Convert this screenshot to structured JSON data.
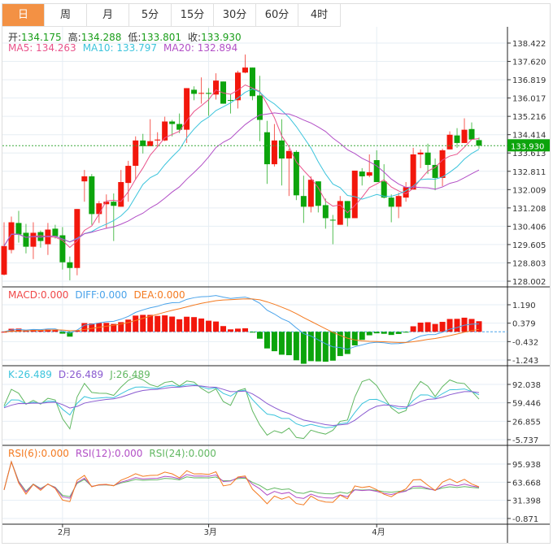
{
  "tabs": [
    "日",
    "周",
    "月",
    "5分",
    "15分",
    "30分",
    "60分",
    "4时"
  ],
  "active_tab": 0,
  "ohlc_legend": {
    "open_label": "开:",
    "open": "134.175",
    "high_label": "高:",
    "high": "134.288",
    "low_label": "低:",
    "low": "133.801",
    "close_label": "收:",
    "close": "133.930"
  },
  "ma_legend": {
    "ma5": "MA5: 134.263",
    "ma10": "MA10: 133.797",
    "ma20": "MA20: 132.894"
  },
  "macd_legend": {
    "macd": "MACD:0.000",
    "diff": "DIFF:0.000",
    "dea": "DEA:0.000"
  },
  "kdj_legend": {
    "k": "K:26.489",
    "d": "D:26.489",
    "j": "J:26.489"
  },
  "rsi_legend": {
    "rsi6": "RSI(6):0.000",
    "rsi12": "RSI(12):0.000",
    "rsi24": "RSI(24):0.000"
  },
  "colors": {
    "up": "#f2170c",
    "down": "#0ca40c",
    "ma5": "#e9528a",
    "ma10": "#3cc4dc",
    "ma20": "#b24fc6",
    "diff": "#4aa3ea",
    "dea": "#f47a20",
    "k": "#3cc4dc",
    "d": "#8a5ad0",
    "j": "#62b862",
    "rsi6": "#f47a20",
    "rsi12": "#b24fc6",
    "rsi24": "#62b862",
    "accent": "#f39144"
  },
  "chart_data": {
    "type": "candlestick",
    "x_tick_labels": [
      {
        "label": "2月",
        "index": 8
      },
      {
        "label": "3月",
        "index": 28
      },
      {
        "label": "4月",
        "index": 51
      }
    ],
    "price_axis_ticks": [
      "138.422",
      "137.620",
      "136.819",
      "136.017",
      "135.216",
      "134.414",
      "133.613",
      "132.811",
      "132.009",
      "131.208",
      "130.406",
      "129.605",
      "128.803",
      "128.002"
    ],
    "price_range": [
      128.002,
      138.422
    ],
    "last_price": "133.930",
    "ohlc": [
      [
        128.29,
        130.58,
        128.25,
        129.54
      ],
      [
        129.37,
        130.83,
        129.22,
        130.58
      ],
      [
        130.55,
        131.08,
        129.69,
        130.05
      ],
      [
        130.12,
        130.51,
        129.22,
        129.51
      ],
      [
        129.51,
        130.58,
        128.97,
        130.12
      ],
      [
        130.15,
        130.22,
        129.47,
        129.76
      ],
      [
        129.62,
        130.55,
        129.15,
        130.26
      ],
      [
        130.3,
        130.47,
        129.87,
        129.97
      ],
      [
        130.01,
        130.37,
        128.51,
        128.83
      ],
      [
        128.83,
        129.08,
        128.04,
        128.58
      ],
      [
        128.58,
        131.16,
        128.26,
        131.16
      ],
      [
        132.37,
        132.87,
        131.48,
        132.59
      ],
      [
        132.59,
        132.69,
        130.47,
        130.94
      ],
      [
        130.94,
        131.51,
        130.55,
        131.41
      ],
      [
        131.37,
        131.8,
        130.3,
        131.48
      ],
      [
        131.48,
        131.84,
        129.76,
        131.3
      ],
      [
        131.26,
        132.87,
        131.26,
        132.34
      ],
      [
        132.3,
        133.27,
        131.48,
        133.05
      ],
      [
        133.05,
        134.34,
        132.44,
        134.16
      ],
      [
        134.16,
        134.45,
        133.59,
        133.91
      ],
      [
        133.91,
        135.09,
        133.91,
        134.13
      ],
      [
        134.16,
        134.52,
        133.88,
        134.2
      ],
      [
        134.16,
        135.2,
        134.13,
        134.99
      ],
      [
        134.99,
        135.06,
        134.34,
        134.88
      ],
      [
        134.88,
        135.34,
        134.48,
        134.63
      ],
      [
        134.63,
        136.45,
        134.05,
        136.45
      ],
      [
        136.38,
        136.53,
        135.92,
        136.2
      ],
      [
        136.22,
        136.92,
        135.77,
        136.24
      ],
      [
        136.24,
        136.45,
        135.24,
        136.2
      ],
      [
        136.17,
        137.1,
        135.95,
        136.78
      ],
      [
        136.74,
        136.74,
        135.77,
        135.77
      ],
      [
        135.93,
        136.2,
        135.34,
        135.92
      ],
      [
        135.92,
        137.21,
        135.56,
        137.13
      ],
      [
        137.13,
        137.92,
        137.1,
        137.35
      ],
      [
        137.35,
        137.35,
        135.92,
        136.1
      ],
      [
        136.13,
        136.99,
        134.13,
        135.06
      ],
      [
        134.52,
        135.02,
        132.26,
        133.12
      ],
      [
        133.12,
        134.88,
        133.02,
        134.16
      ],
      [
        134.16,
        135.09,
        132.19,
        133.37
      ],
      [
        133.37,
        133.8,
        131.73,
        133.7
      ],
      [
        133.66,
        133.73,
        131.55,
        131.76
      ],
      [
        131.73,
        132.62,
        130.55,
        131.26
      ],
      [
        131.26,
        132.59,
        131.01,
        132.44
      ],
      [
        132.37,
        132.37,
        131.01,
        131.3
      ],
      [
        131.33,
        131.62,
        130.3,
        130.76
      ],
      [
        130.69,
        130.9,
        129.62,
        130.67
      ],
      [
        130.47,
        131.73,
        130.47,
        131.51
      ],
      [
        131.51,
        131.51,
        130.4,
        130.76
      ],
      [
        130.76,
        132.84,
        130.76,
        132.84
      ],
      [
        132.8,
        132.95,
        132.19,
        132.59
      ],
      [
        132.62,
        133.55,
        132.55,
        132.77
      ],
      [
        133.3,
        133.73,
        132.34,
        132.34
      ],
      [
        132.37,
        133.12,
        131.62,
        131.66
      ],
      [
        131.66,
        131.8,
        130.58,
        131.26
      ],
      [
        131.26,
        131.87,
        130.76,
        131.73
      ],
      [
        131.66,
        132.34,
        131.48,
        132.12
      ],
      [
        132.01,
        133.84,
        132.16,
        133.55
      ],
      [
        133.55,
        133.77,
        132.95,
        133.63
      ],
      [
        133.63,
        134.02,
        132.69,
        133.09
      ],
      [
        133.09,
        133.37,
        131.98,
        132.52
      ],
      [
        132.52,
        133.8,
        132.16,
        133.73
      ],
      [
        133.77,
        134.56,
        133.77,
        134.41
      ],
      [
        134.38,
        134.7,
        133.84,
        134.05
      ],
      [
        134.05,
        135.13,
        134.05,
        134.63
      ],
      [
        134.66,
        134.95,
        134.2,
        134.2
      ],
      [
        134.175,
        134.288,
        133.801,
        133.93
      ]
    ],
    "moving_averages": [
      5,
      10,
      20
    ],
    "macd_axis_ticks": [
      "1.190",
      "0.379",
      "-0.432",
      "-1.243"
    ],
    "macd_range": [
      -1.243,
      1.19
    ],
    "kdj_axis_ticks": [
      "92.038",
      "59.446",
      "26.855",
      "-5.737"
    ],
    "kdj_range": [
      -5.737,
      92.038
    ],
    "rsi_axis_ticks": [
      "95.938",
      "63.668",
      "31.398",
      "-0.871"
    ],
    "rsi_range": [
      -0.871,
      95.938
    ],
    "grid": true
  }
}
